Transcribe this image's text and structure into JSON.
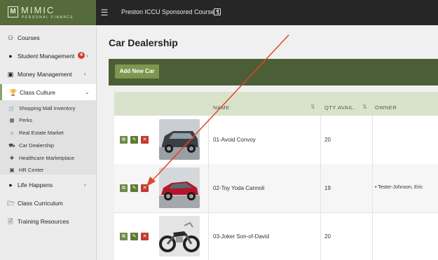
{
  "brand": {
    "logo_letter": "M",
    "name": "MIMIC",
    "tagline": "PERSONAL FINANCE"
  },
  "topbar": {
    "menu_icon": "hamburger-icon",
    "course_title": "Preston ICCU Sponsored Course 1",
    "course_dropdown_icon": "dropdown-icon"
  },
  "sidebar": {
    "items": [
      {
        "label": "Courses",
        "icon": "users-icon"
      },
      {
        "label": "Student Management",
        "icon": "user-icon",
        "badge": "4"
      },
      {
        "label": "Money Management",
        "icon": "money-icon"
      },
      {
        "label": "Class Culture",
        "icon": "culture-icon"
      },
      {
        "label": "Life Happens",
        "icon": "life-icon"
      },
      {
        "label": "Class Curriculum",
        "icon": "folder-icon"
      },
      {
        "label": "Training Resources",
        "icon": "document-icon"
      }
    ],
    "sub_items": [
      {
        "label": "Shopping Mall Inventory",
        "icon": "cart-icon"
      },
      {
        "label": "Perks",
        "icon": "gift-icon"
      },
      {
        "label": "Real Estate Market",
        "icon": "house-icon"
      },
      {
        "label": "Car Dealership",
        "icon": "car-icon"
      },
      {
        "label": "Healthcare Marketplace",
        "icon": "medkit-icon"
      },
      {
        "label": "HR Center",
        "icon": "briefcase-icon"
      }
    ]
  },
  "main": {
    "title": "Car Dealership",
    "add_button": "Add New Car",
    "columns": [
      "NAME",
      "QTY AVAIL.",
      "OWNER"
    ],
    "rows": [
      {
        "name": "01-Avoid Convoy",
        "qty": "20",
        "owner": ""
      },
      {
        "name": "02-Toy Yoda Cannoli",
        "qty": "19",
        "owner": "Tester-Johnson, Eric"
      },
      {
        "name": "03-Joker Son-of-David",
        "qty": "20",
        "owner": ""
      }
    ]
  },
  "colors": {
    "brand_green": "#556b3b",
    "header_bar": "#4b5e35",
    "button_green": "#7c974f",
    "delete_red": "#c63a2e",
    "annotation_arrow": "#e0452b"
  }
}
